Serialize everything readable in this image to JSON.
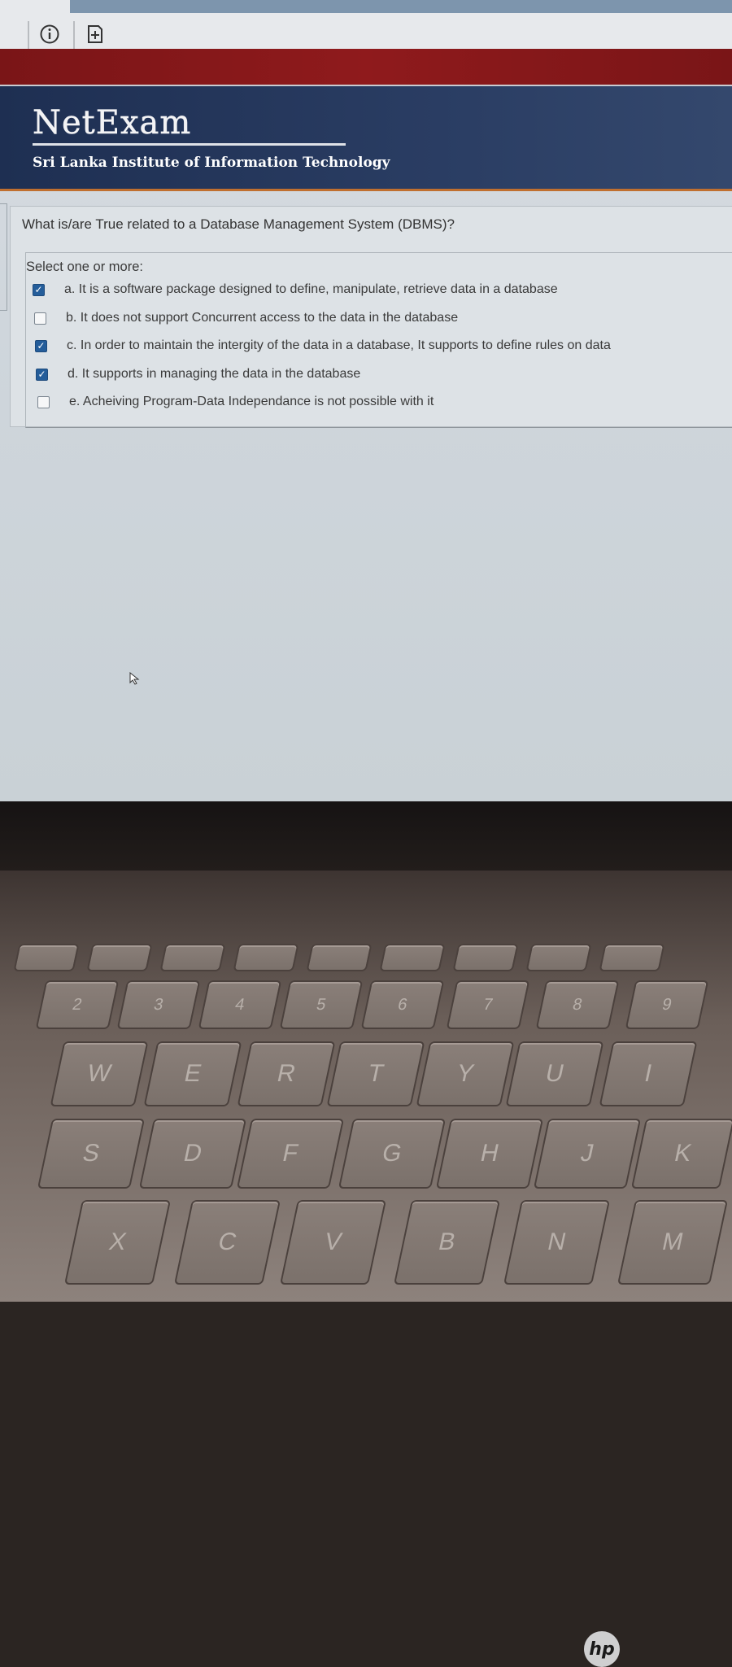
{
  "browser": {
    "info_icon": "info-icon",
    "add_tab_icon": "add-tab-icon"
  },
  "header": {
    "logo": "NetExam",
    "institution": "Sri Lanka Institute of Information Technology"
  },
  "question": {
    "text": "What is/are True related to a Database Management System (DBMS)?",
    "prompt": "Select one or more:",
    "options": [
      {
        "label": "a. It is a software package designed to define, manipulate, retrieve data in a database",
        "checked": true
      },
      {
        "label": "b. It does not support Concurrent access to the data in the database",
        "checked": false
      },
      {
        "label": "c. In order to maintain the intergity of the data in a database, It supports to define rules on data",
        "checked": true
      },
      {
        "label": "d. It supports in managing the data in the database",
        "checked": true
      },
      {
        "label": "e. Acheiving Program-Data Independance is not possible with it",
        "checked": false
      }
    ]
  },
  "laptop": {
    "brand": "hp"
  },
  "keyboard": {
    "number_row": [
      "2",
      "3",
      "4",
      "5",
      "6",
      "7",
      "8",
      "9"
    ],
    "top_row": [
      "W",
      "E",
      "R",
      "T",
      "Y",
      "U",
      "I"
    ],
    "home_row": [
      "S",
      "D",
      "F",
      "G",
      "H",
      "J",
      "K"
    ],
    "bottom_row": [
      "X",
      "C",
      "V",
      "B",
      "N",
      "M"
    ]
  }
}
